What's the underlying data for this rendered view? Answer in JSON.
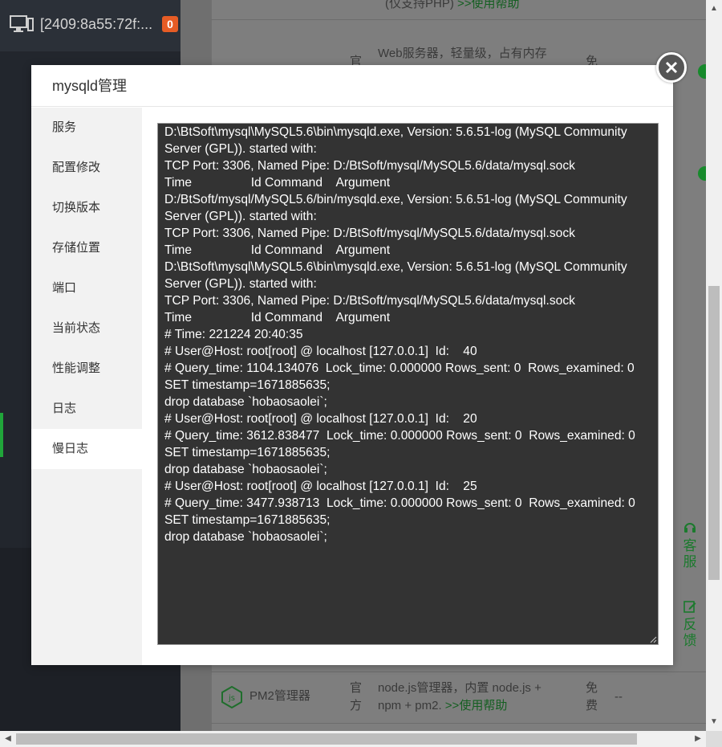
{
  "background": {
    "host_label": "[2409:8a55:72f:...",
    "host_badge": "0",
    "nginx_desc_1": "(仅支持PHP)",
    "nginx_help": ">>使用帮助",
    "web_type": "官",
    "web_desc": "Web服务器，轻量级，占有内存",
    "web_price": "免",
    "pm2_name": "PM2管理器",
    "pm2_type_1": "官",
    "pm2_type_2": "方",
    "pm2_desc_1": "node.js管理器，内置 node.js +",
    "pm2_desc_2": "npm + pm2.",
    "pm2_help": ">>使用帮助",
    "pm2_price_1": "免",
    "pm2_price_2": "费",
    "pm2_version": "--"
  },
  "float_tools": {
    "service_label_1": "客",
    "service_label_2": "服",
    "feedback_label_1": "反",
    "feedback_label_2": "馈"
  },
  "modal": {
    "title": "mysqld管理",
    "tabs": [
      {
        "label": "服务"
      },
      {
        "label": "配置修改"
      },
      {
        "label": "切换版本"
      },
      {
        "label": "存储位置"
      },
      {
        "label": "端口"
      },
      {
        "label": "当前状态"
      },
      {
        "label": "性能调整"
      },
      {
        "label": "日志"
      },
      {
        "label": "慢日志"
      }
    ],
    "active_tab": "慢日志",
    "log_lines": [
      "D:\\BtSoft\\mysql\\MySQL5.6\\bin\\mysqld.exe, Version: 5.6.51-log (MySQL Community",
      "Server (GPL)). started with:",
      "TCP Port: 3306, Named Pipe: D:/BtSoft/mysql/MySQL5.6/data/mysql.sock",
      "Time                 Id Command    Argument",
      "D:/BtSoft/mysql/MySQL5.6/bin/mysqld.exe, Version: 5.6.51-log (MySQL Community",
      "Server (GPL)). started with:",
      "TCP Port: 3306, Named Pipe: D:/BtSoft/mysql/MySQL5.6/data/mysql.sock",
      "Time                 Id Command    Argument",
      "D:\\BtSoft\\mysql\\MySQL5.6\\bin\\mysqld.exe, Version: 5.6.51-log (MySQL Community",
      "Server (GPL)). started with:",
      "TCP Port: 3306, Named Pipe: D:/BtSoft/mysql/MySQL5.6/data/mysql.sock",
      "Time                 Id Command    Argument",
      "# Time: 221224 20:40:35",
      "# User@Host: root[root] @ localhost [127.0.0.1]  Id:    40",
      "# Query_time: 1104.134076  Lock_time: 0.000000 Rows_sent: 0  Rows_examined: 0",
      "SET timestamp=1671885635;",
      "drop database `hobaosaolei`;",
      "# User@Host: root[root] @ localhost [127.0.0.1]  Id:    20",
      "# Query_time: 3612.838477  Lock_time: 0.000000 Rows_sent: 0  Rows_examined: 0",
      "SET timestamp=1671885635;",
      "drop database `hobaosaolei`;",
      "# User@Host: root[root] @ localhost [127.0.0.1]  Id:    25",
      "# Query_time: 3477.938713  Lock_time: 0.000000 Rows_sent: 0  Rows_examined: 0",
      "SET timestamp=1671885635;",
      "drop database `hobaosaolei`;"
    ]
  },
  "colors": {
    "accent_green": "#20a53a",
    "log_background": "#333333",
    "badge_orange": "#e65c25"
  }
}
